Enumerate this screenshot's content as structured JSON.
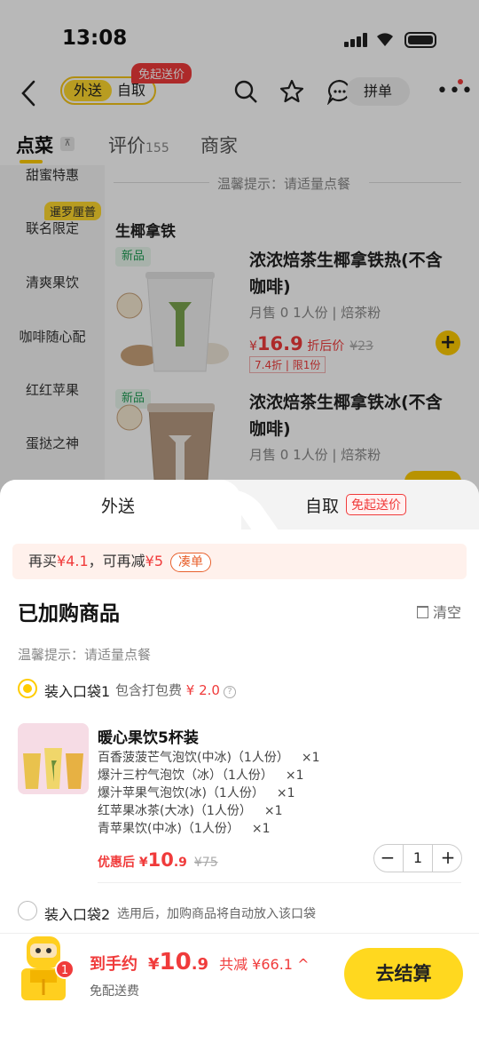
{
  "status_bar": {
    "time": "13:08"
  },
  "header": {
    "mode_delivery": "外送",
    "mode_pickup": "自取",
    "free_delivery_tag": "免起送价",
    "group_order": "拼单"
  },
  "store_tabs": [
    {
      "label": "点菜",
      "extra": ""
    },
    {
      "label": "评价",
      "extra": "155"
    },
    {
      "label": "商家",
      "extra": ""
    }
  ],
  "sidebar": {
    "items": [
      "甜蜜特惠",
      "联名限定",
      "清爽果饮",
      "咖啡随心配",
      "红红苹果",
      "蛋挞之神"
    ],
    "tag": "暹罗厘普"
  },
  "menu": {
    "tip": "温馨提示：请适量点餐",
    "section": "生椰拿铁",
    "products": [
      {
        "tag": "新品",
        "name": "浓浓焙茶生椰拿铁热(不含咖啡)",
        "meta": "月售 0  1人份 | 焙茶粉",
        "price_prefix": "¥",
        "price": "16.9",
        "price_note": "折后价",
        "original": "¥23",
        "discount": "7.4折 | 限1份"
      },
      {
        "tag": "新品",
        "name": "浓浓焙茶生椰拿铁冰(不含咖啡)",
        "meta": "月售 0  1人份 | 焙茶粉"
      }
    ]
  },
  "sheet": {
    "tab_delivery": "外送",
    "tab_pickup": "自取",
    "pickup_tag": "免起送价",
    "promo": {
      "prefix": "再买",
      "amount": "¥4.1",
      "mid": "，可再减",
      "cut": "¥5",
      "button": "凑单"
    },
    "title": "已加购商品",
    "clear": "清空",
    "tip": "温馨提示：请适量点餐",
    "bag1": {
      "label": "装入口袋1",
      "fee_text": "包含打包费",
      "fee": "¥ 2.0"
    },
    "item": {
      "name": "暖心果饮5杯装",
      "subs": [
        {
          "name": "百香菠菠芒气泡饮(中冰)（1人份）",
          "qty": "×1"
        },
        {
          "name": "爆汁三柠气泡饮（冰）（1人份）",
          "qty": "×1"
        },
        {
          "name": "爆汁苹果气泡饮(冰)（1人份）",
          "qty": "×1"
        },
        {
          "name": "红苹果冰茶(大冰)（1人份）",
          "qty": "×1"
        },
        {
          "name": "青苹果饮(中冰)（1人份）",
          "qty": "×1"
        }
      ],
      "price_label": "优惠后",
      "price_symbol": "¥",
      "price_int": "10",
      "price_dec": ".9",
      "original": "¥75",
      "quantity": "1"
    },
    "bag2": {
      "label": "装入口袋2",
      "note": "选用后，加购商品将自动放入该口袋"
    }
  },
  "footer": {
    "cart_count": "1",
    "total_label": "到手约",
    "total_symbol": "¥",
    "total_int": "10",
    "total_dec": ".9",
    "saved": "共减 ¥66.1",
    "shipping": "免配送费",
    "checkout": "去结算"
  },
  "colors": {
    "accent_yellow": "#ffd81f",
    "price_red": "#f03b3b",
    "new_green": "#1f9d55"
  }
}
